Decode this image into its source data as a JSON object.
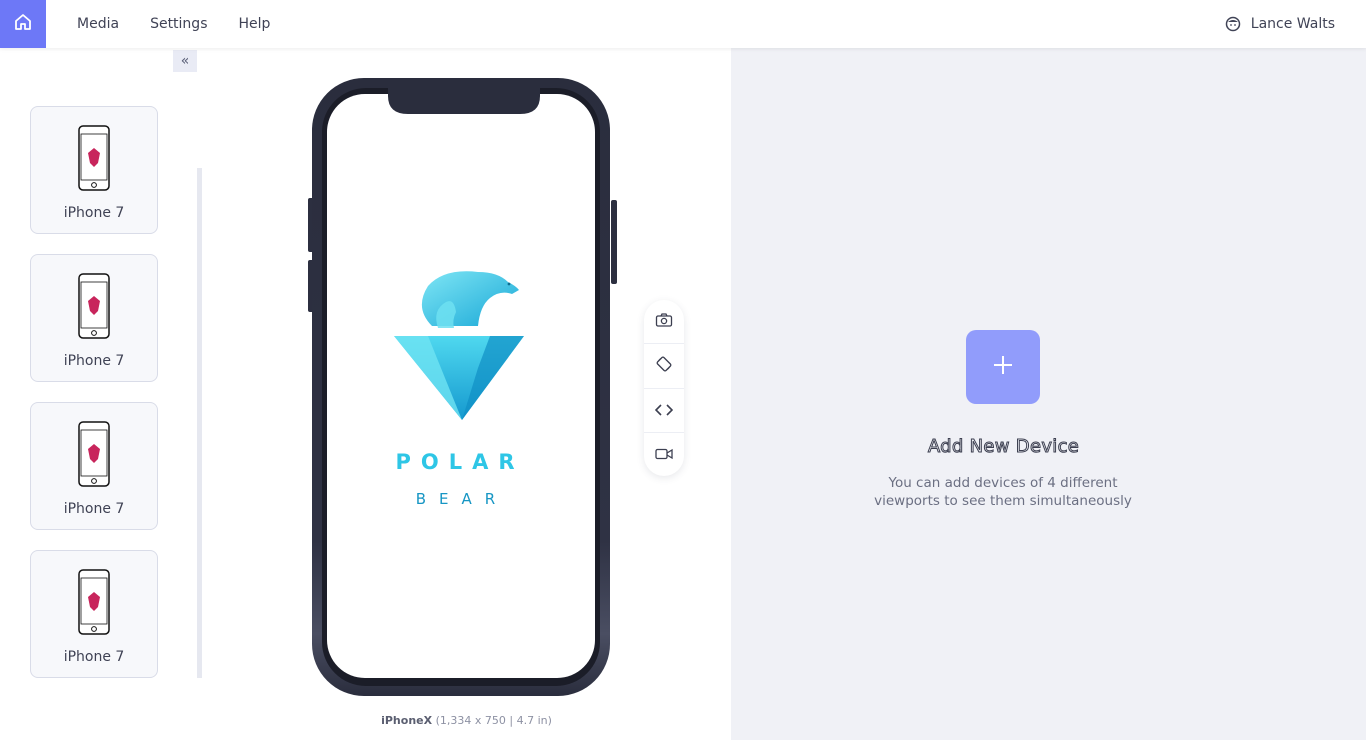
{
  "nav": {
    "items": [
      "Media",
      "Settings",
      "Help"
    ],
    "user_name": "Lance Walts"
  },
  "sidebar": {
    "collapse_glyph": "«",
    "devices": [
      {
        "label": "iPhone 7"
      },
      {
        "label": "iPhone 7"
      },
      {
        "label": "iPhone 7"
      },
      {
        "label": "iPhone 7"
      }
    ]
  },
  "preview": {
    "logo_line1": "POLAR",
    "logo_line2": "BEAR",
    "device_name": "iPhoneX",
    "device_specs": "(1,334 x 750  | 4.7 in)",
    "tools": [
      "camera-icon",
      "rotate-icon",
      "code-icon",
      "video-icon"
    ]
  },
  "add_device": {
    "title": "Add New Device",
    "description": "You can add devices of 4 different viewports to see them simultaneously"
  },
  "colors": {
    "accent": "#6d78f7",
    "add_button": "#919cfb",
    "panel_bg": "#f0f1f6",
    "phone_frame": "#2c2f40",
    "logo_cyan": "#2ec6e6"
  }
}
